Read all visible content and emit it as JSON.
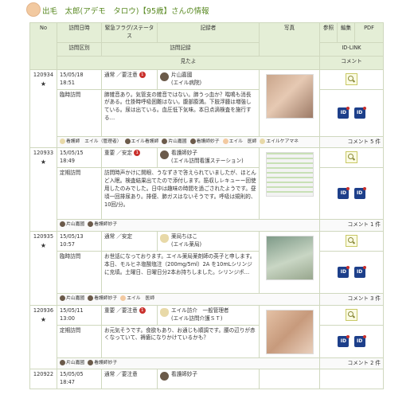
{
  "header": {
    "title": "出毛　太郎(アデモ　タロウ)【95歳】さんの情報"
  },
  "columns": {
    "no": "No",
    "visit_datetime": "訪問日時",
    "flag": "緊急フラグ/ステータス",
    "recorder": "記録者",
    "photo": "写真",
    "ref": "参照",
    "edit": "編集",
    "pdf": "PDF",
    "visit_type": "訪問区別",
    "visit_record": "訪問記録",
    "id_link": "ID-LINK",
    "seen": "見たよ",
    "comment": "コメント"
  },
  "records": [
    {
      "no": "120934",
      "star": "★",
      "datetime": "15/05/18 18:51",
      "flag": "通常 ／要注意",
      "badge": "1",
      "recorder_name": "片山嘉國",
      "recorder_org": "(エイル病院)",
      "visit_type": "臨時訪問",
      "text": "肺雑音あり。気管支の雑音ではない。肺うっ血か？喘鳴も消長がある。仕掛時呼吸困難はない。腹部膨満。下肢浮腫は増強している。尿は出ている。血圧低下気味。本日点滴検査を施行する…",
      "people": [
        "看護師　エイル（管理者）",
        "エイル看護師",
        "片山嘉國",
        "看護師妙子",
        "エイル　医師",
        "エイルケアマネ"
      ],
      "comment": "コメント 5 件"
    },
    {
      "no": "120933",
      "star": "★",
      "datetime": "15/05/15 18:49",
      "flag": "重要 ／安定",
      "badge": "1",
      "recorder_name": "看護師妙子",
      "recorder_org": "(エイル訪問看護ステーション)",
      "visit_type": "定期訪問",
      "text": "訪問時声かけに開眼、うなずきで答えられていましたが、ほとんど入眠。検査結果出てたので添付します。筋収しレキューー回使用したのみでした。日中は趣味の時間を過ごされたようです。昼頃一回排尿あり。排便、肺ガスはないそうです。呼吸は規則的、10回/分。",
      "people": [
        "片山嘉國",
        "看護師妙子"
      ],
      "comment": "コメント 1 件"
    },
    {
      "no": "120935",
      "star": "★",
      "datetime": "15/05/13 10:57",
      "flag": "通常 ／安定",
      "badge": "",
      "recorder_name": "薬局ちほこ",
      "recorder_org": "(エイル薬局)",
      "visit_type": "臨時訪問",
      "text": "お世話になっております。エイル薬局薬剤師の英子と申します。本日、モルヒネ塩酸塩注（200mg/5ml）2A を10mLシリンジに充填。土曜日、日曜日分2本お持ちしました。シリンジポ…",
      "people": [
        "片山嘉國",
        "看護師妙子",
        "エイル　医師"
      ],
      "comment": "コメント 3 件"
    },
    {
      "no": "120936",
      "star": "★",
      "datetime": "15/05/11 13:00",
      "flag": "重要 ／要注意",
      "badge": "1",
      "recorder_name": "エイル訪介　一般管理者",
      "recorder_org": "(エイル訪問介護ＳＴ)",
      "visit_type": "定期訪問",
      "text": "お元気そうです。食欲もあり、お通じも順調です。腰の辺りが赤くなっていて、褥瘡になりかけているかも？",
      "people": [
        "片山嘉國",
        "看護師妙子"
      ],
      "comment": "コメント 2 件"
    },
    {
      "no": "120922",
      "star": "",
      "datetime": "15/05/05 18:47",
      "flag": "通常 ／要注意",
      "badge": "",
      "recorder_name": "看護師妙子",
      "recorder_org": "",
      "visit_type": "",
      "text": "",
      "people": [],
      "comment": ""
    }
  ]
}
